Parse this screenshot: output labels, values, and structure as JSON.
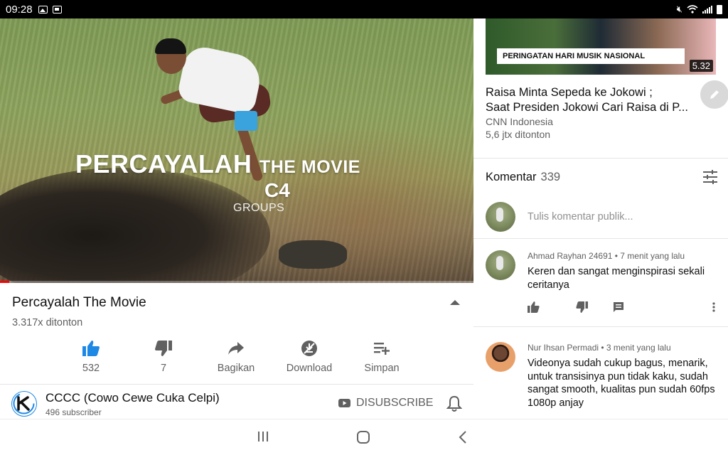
{
  "status_bar": {
    "time": "09:28",
    "icons": [
      "image-icon",
      "gallery-icon",
      "mute-icon",
      "wifi-icon",
      "signal-icon",
      "battery-icon"
    ]
  },
  "video": {
    "overlay_title_main": "PERCAYALAH",
    "overlay_title_sub": "THE MOVIE",
    "overlay_logo": "C4",
    "overlay_groups": "GROUPS",
    "progress_fraction": 0.02
  },
  "video_info": {
    "title": "Percayalah The Movie",
    "views": "3.317x ditonton",
    "actions": {
      "like": "532",
      "dislike": "7",
      "share": "Bagikan",
      "download": "Download",
      "save": "Simpan"
    }
  },
  "channel": {
    "name": "CCCC (Cowo Cewe Cuka Celpi)",
    "subscribers": "496 subscriber",
    "unsubscribe_label": "DISUBSCRIBE"
  },
  "related_video": {
    "banner": "PERINGATAN HARI MUSIK NASIONAL",
    "duration": "5.32",
    "title_line1": "Raisa Minta Sepeda ke Jokowi ;",
    "title_line2": "Saat Presiden Jokowi Cari Raisa di P...",
    "channel": "CNN Indonesia",
    "views": "5,6 jtx ditonton"
  },
  "comments": {
    "header": "Komentar",
    "count": "339",
    "input_placeholder": "Tulis komentar publik...",
    "items": [
      {
        "author": "Ahmad Rayhan 24691",
        "time": "7 menit yang lalu",
        "text": "Keren dan sangat menginspirasi sekali ceritanya"
      },
      {
        "author": "Nur Ihsan Permadi",
        "time": "3 menit yang lalu",
        "text": "Videonya sudah cukup bagus, menarik, untuk transisinya pun tidak kaku, sudah sangat smooth, kualitas pun sudah 60fps 1080p anjay"
      }
    ]
  },
  "colors": {
    "accent_blue": "#1e88e5",
    "progress_red": "#ff0000",
    "secondary_text": "#606060"
  }
}
